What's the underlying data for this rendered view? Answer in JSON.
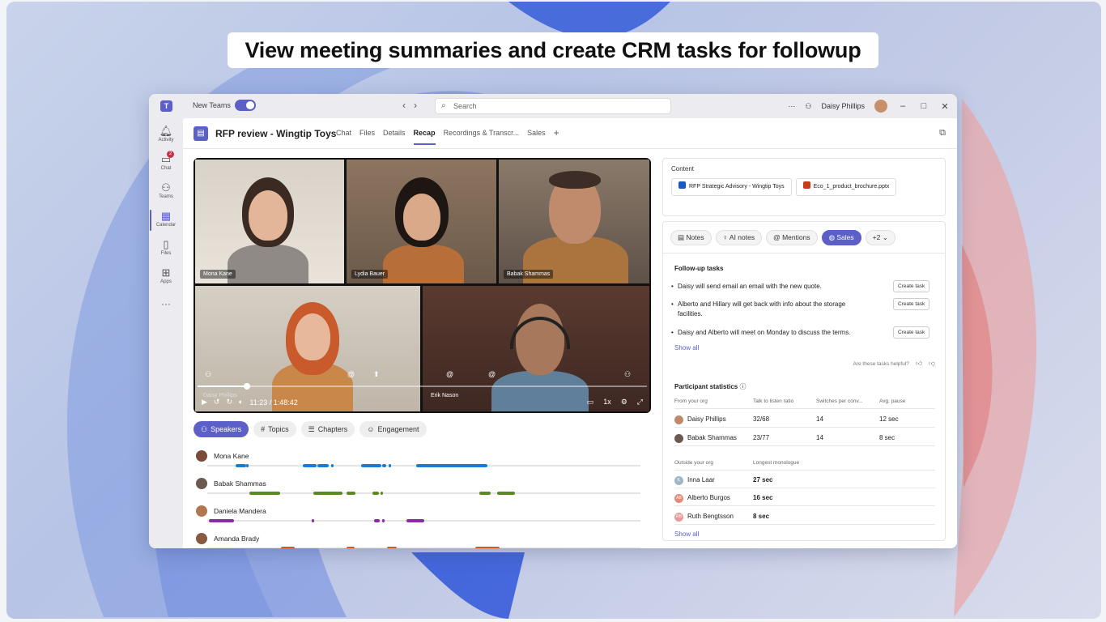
{
  "banner": "View meeting summaries and create CRM tasks for followup",
  "titlebar": {
    "new_teams": "New Teams",
    "search_placeholder": "Search",
    "user_name": "Daisy Phillips"
  },
  "rail": [
    {
      "label": "Activity",
      "icon": "bell-icon"
    },
    {
      "label": "Chat",
      "icon": "chat-icon",
      "badge": "2"
    },
    {
      "label": "Teams",
      "icon": "teams-icon"
    },
    {
      "label": "Calendar",
      "icon": "calendar-icon"
    },
    {
      "label": "Files",
      "icon": "file-icon"
    },
    {
      "label": "Apps",
      "icon": "apps-icon"
    }
  ],
  "header": {
    "title": "RFP review - Wingtip Toys",
    "tabs": [
      "Chat",
      "Files",
      "Details",
      "Recap",
      "Recordings & Transcr...",
      "Sales"
    ],
    "active_tab": "Recap"
  },
  "video": {
    "participants": [
      "Mona Kane",
      "Lydia Bauer",
      "Babak Shammas",
      "Daisy Phillips",
      "Erik Nason"
    ],
    "time": "11:23 / 1:48:42",
    "speed": "1x",
    "progress": 0.11
  },
  "recap_tabs": [
    "Speakers",
    "Topics",
    "Chapters",
    "Engagement"
  ],
  "speakers": [
    {
      "name": "Mona Kane"
    },
    {
      "name": "Babak Shammas"
    },
    {
      "name": "Daniela Mandera"
    },
    {
      "name": "Amanda Brady"
    }
  ],
  "content": {
    "label": "Content",
    "files": [
      "RFP Strategic Advisory - Wingtip Toys",
      "Eco_1_product_brochure.pptx"
    ]
  },
  "notes": {
    "pills": [
      "Notes",
      "AI notes",
      "Mentions",
      "Sales",
      "+2"
    ],
    "active": "Sales",
    "followup_title": "Follow-up tasks",
    "tasks": [
      "Daisy will send email an email with the new quote.",
      "Alberto and Hillary will get back with info about the storage facilities.",
      "Daisy and Alberto will meet on Monday to discuss the terms."
    ],
    "create_task": "Create task",
    "show_all": "Show all",
    "helpful": "Are these tasks helpful?",
    "stats_title": "Participant statistics",
    "org_headers": [
      "From your org",
      "Talk to listen ratio",
      "Switches per conv...",
      "Avg. pause"
    ],
    "org_rows": [
      [
        "Daisy Phillips",
        "32/68",
        "14",
        "12 sec"
      ],
      [
        "Babak Shammas",
        "23/77",
        "14",
        "8 sec"
      ]
    ],
    "outside_headers": [
      "Outside your org",
      "Longest monologue"
    ],
    "outside_rows": [
      [
        "Inna Laar",
        "27 sec",
        "IL"
      ],
      [
        "Alberto Burgos",
        "16 sec",
        "AB"
      ],
      [
        "Ruth Bengtsson",
        "8 sec",
        "RB"
      ]
    ]
  }
}
